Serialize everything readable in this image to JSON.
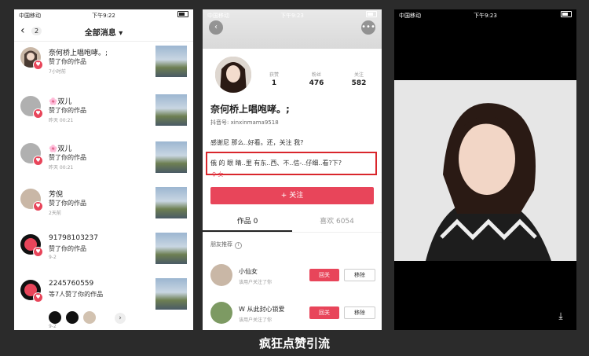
{
  "status": {
    "carrier": "中国移动",
    "time1": "下午9:22",
    "time2": "下午9:23",
    "time3": "下午9:23"
  },
  "p1": {
    "header": {
      "title": "全部消息 ▾",
      "badge": "2"
    },
    "messages": [
      {
        "name": "奈何桥上唱咆哮。;",
        "text": "赞了你的作品",
        "time": "7小时前"
      },
      {
        "name": "🌸双儿",
        "text": "赞了你的作品",
        "time": "昨天 00:21"
      },
      {
        "name": "🌸双儿",
        "text": "赞了你的作品",
        "time": "昨天 00:21"
      },
      {
        "name": "芳倪",
        "text": "赞了你的作品",
        "time": "2天前"
      },
      {
        "name": "91798103237",
        "text": "赞了你的作品",
        "time": "9-2"
      },
      {
        "name": "2245760559",
        "text": "等7人赞了你的作品",
        "time": "9-2"
      }
    ]
  },
  "p2": {
    "stats": [
      {
        "label": "获赞",
        "value": "1"
      },
      {
        "label": "粉丝",
        "value": "476"
      },
      {
        "label": "关注",
        "value": "582"
      }
    ],
    "name": "奈何桥上唱咆哮。;",
    "id": "抖音号: xinxinmama9518",
    "bio1": "感谢尼 那么..好看。还，关注 我?",
    "bio2": "俄 的 眼 睛..里 有东..西、不..信-..仔细..看?下?",
    "gender": "♀ 女",
    "follow": "+ 关注",
    "tabs": [
      "作品 0",
      "喜欢 6054"
    ],
    "rec_title": "朋友推荐",
    "recs": [
      {
        "name": "小仙女",
        "sub": "该用户关注了你",
        "back": "回关",
        "remove": "移除"
      },
      {
        "name": "W 从此封心锁爱",
        "sub": "该用户关注了你",
        "back": "回关",
        "remove": "移除"
      }
    ]
  },
  "caption": "疯狂点赞引流"
}
